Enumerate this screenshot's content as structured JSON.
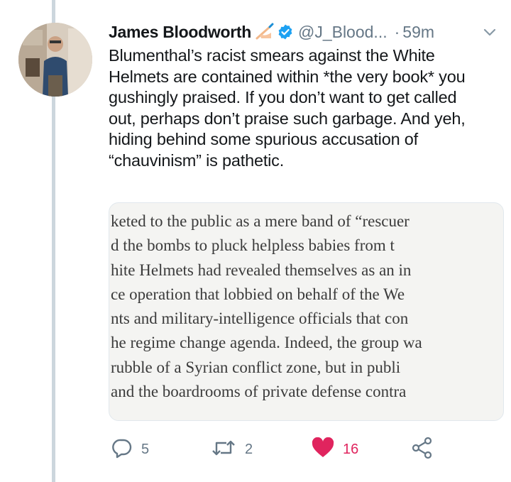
{
  "tweet": {
    "author_name": "James Bloodworth",
    "name_emoji": "writing-hand-emoji",
    "verified": true,
    "handle": "@J_Blood...",
    "separator": "·",
    "time": "59m",
    "text": "Blumenthal’s racist smears against the White\nHelmets are contained within *the very book* you\ngushingly praised. If you don’t want to get called\nout, perhaps don’t praise such garbage. And yeh,\nhiding behind some spurious accusation of\n“chauvinism” is pathetic.",
    "media_lines": [
      "keted to the public as a mere band of “rescuer",
      "d the bombs to pluck helpless babies from t",
      "hite Helmets had revealed themselves as an in",
      "ce operation that lobbied on behalf of the We",
      "nts and military-intelligence officials that con",
      "he regime change agenda. Indeed, the group wa",
      "rubble of a Syrian conflict zone, but in publi",
      "and the boardrooms of private defense contra"
    ],
    "actions": {
      "replies": "5",
      "retweets": "2",
      "likes": "16",
      "liked": true
    }
  },
  "colors": {
    "accent": "#1da1f2",
    "like": "#e0245e",
    "muted": "#657786",
    "thread_line": "#ccd6dd"
  }
}
